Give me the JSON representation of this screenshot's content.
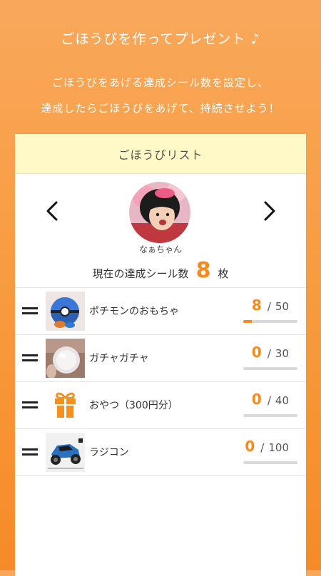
{
  "hero": {
    "title": "ごほうびを作ってプレゼント ♪",
    "desc_line1": "ごほうびをあげる達成シール数を設定し、",
    "desc_line2": "達成したらごほうびをあげて、持続させよう！"
  },
  "card": {
    "header": "ごほうびリスト",
    "child_name": "なぁちゃん",
    "sticker_label": "現在の達成シール数",
    "sticker_count": "8",
    "sticker_unit": "枚"
  },
  "rewards": [
    {
      "name": "ポチモンのおもちゃ",
      "current": "8",
      "separator": "/",
      "goal": "50",
      "progress": 0.16,
      "thumb": "toy-ball-thumbnail"
    },
    {
      "name": "ガチャガチャ",
      "current": "0",
      "separator": "/",
      "goal": "30",
      "progress": 0,
      "thumb": "capsule-toy-thumbnail"
    },
    {
      "name": "おやつ（300円分）",
      "current": "0",
      "separator": "/",
      "goal": "40",
      "progress": 0,
      "thumb": "gift-icon"
    },
    {
      "name": "ラジコン",
      "current": "0",
      "separator": "/",
      "goal": "100",
      "progress": 0,
      "thumb": "rc-car-thumbnail"
    }
  ],
  "colors": {
    "accent": "#f58a1f",
    "header_bg": "#fef9c6",
    "background_top": "#f9a85b",
    "background_bottom": "#f58b26"
  }
}
